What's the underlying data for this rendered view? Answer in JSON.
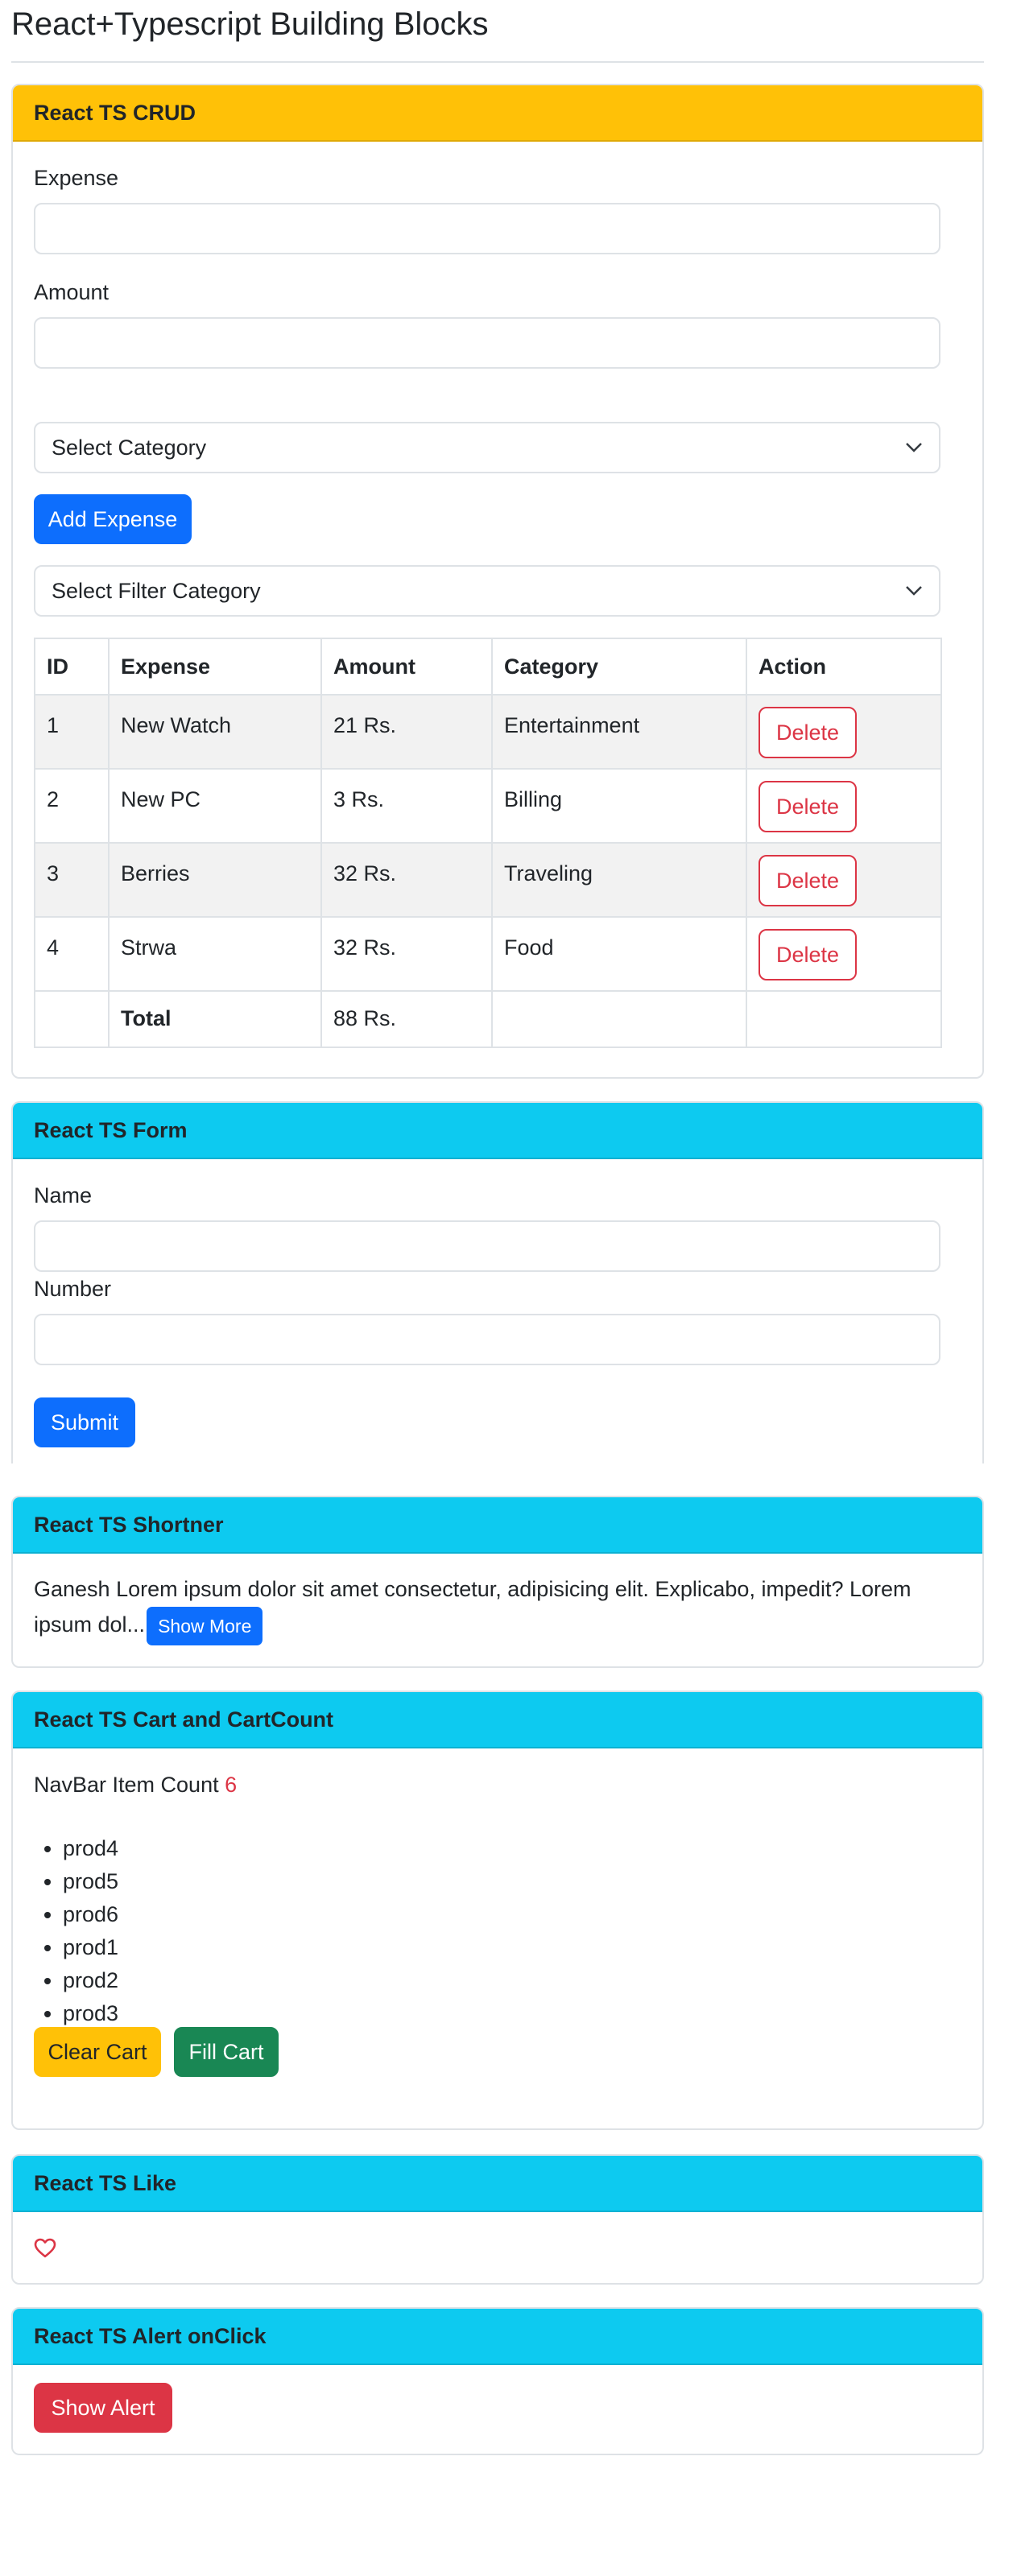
{
  "page": {
    "title": "React+Typescript Building Blocks"
  },
  "crud": {
    "header": "React TS CRUD",
    "expense_label": "Expense",
    "expense_value": "",
    "amount_label": "Amount",
    "amount_value": "",
    "category_select": "Select Category",
    "add_button": "Add Expense",
    "filter_select": "Select Filter Category",
    "table": {
      "columns": [
        "ID",
        "Expense",
        "Amount",
        "Category",
        "Action"
      ],
      "rows": [
        {
          "id": "1",
          "expense": "New Watch",
          "amount": "21 Rs.",
          "category": "Entertainment",
          "action": "Delete"
        },
        {
          "id": "2",
          "expense": "New PC",
          "amount": "3 Rs.",
          "category": "Billing",
          "action": "Delete"
        },
        {
          "id": "3",
          "expense": "Berries",
          "amount": "32 Rs.",
          "category": "Traveling",
          "action": "Delete"
        },
        {
          "id": "4",
          "expense": "Strwa",
          "amount": "32 Rs.",
          "category": "Food",
          "action": "Delete"
        }
      ],
      "total_label": "Total",
      "total_value": "88 Rs."
    }
  },
  "form": {
    "header": "React TS Form",
    "name_label": "Name",
    "name_value": "",
    "number_label": "Number",
    "number_value": "",
    "submit_button": "Submit"
  },
  "shortner": {
    "header": "React TS Shortner",
    "text": "Ganesh Lorem ipsum dolor sit amet consectetur, adipisicing elit. Explicabo, impedit? Lorem ipsum dol...",
    "show_more_button": "Show More"
  },
  "cart": {
    "header": "React TS Cart and CartCount",
    "count_label": "NavBar Item Count",
    "count_value": "6",
    "items": [
      "prod4",
      "prod5",
      "prod6",
      "prod1",
      "prod2",
      "prod3"
    ],
    "clear_button": "Clear Cart",
    "fill_button": "Fill Cart"
  },
  "like": {
    "header": "React TS Like",
    "icon": "heart-outline-icon"
  },
  "alert": {
    "header": "React TS Alert onClick",
    "button": "Show Alert"
  },
  "colors": {
    "warning": "#ffc107",
    "info": "#0dcaf0",
    "primary": "#0d6efd",
    "success": "#198754",
    "danger": "#dc3545"
  }
}
